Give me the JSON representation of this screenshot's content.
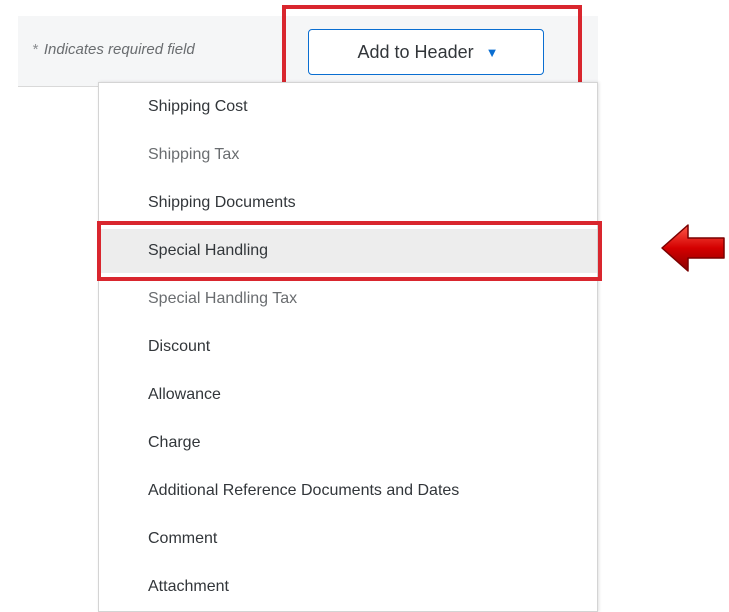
{
  "form": {
    "required_note": "Indicates required field",
    "required_marker": "*"
  },
  "toolbar": {
    "add_to_header_label": "Add to Header",
    "caret_icon": "caret-down-icon"
  },
  "menu": {
    "items": [
      {
        "label": "Shipping Cost"
      },
      {
        "label": "Shipping Tax"
      },
      {
        "label": "Shipping Documents"
      },
      {
        "label": "Special Handling",
        "selected": true
      },
      {
        "label": "Special Handling Tax"
      },
      {
        "label": "Discount"
      },
      {
        "label": "Allowance"
      },
      {
        "label": "Charge"
      },
      {
        "label": "Additional Reference Documents and Dates"
      },
      {
        "label": "Comment"
      },
      {
        "label": "Attachment"
      }
    ]
  },
  "annotations": {
    "highlight_color": "#d9262e",
    "arrow_color": "#d40000",
    "arrow_icon": "left-arrow-icon"
  },
  "colors": {
    "accent": "#0a6ed1",
    "selected_background": "#ededed",
    "text": "#32363a"
  }
}
